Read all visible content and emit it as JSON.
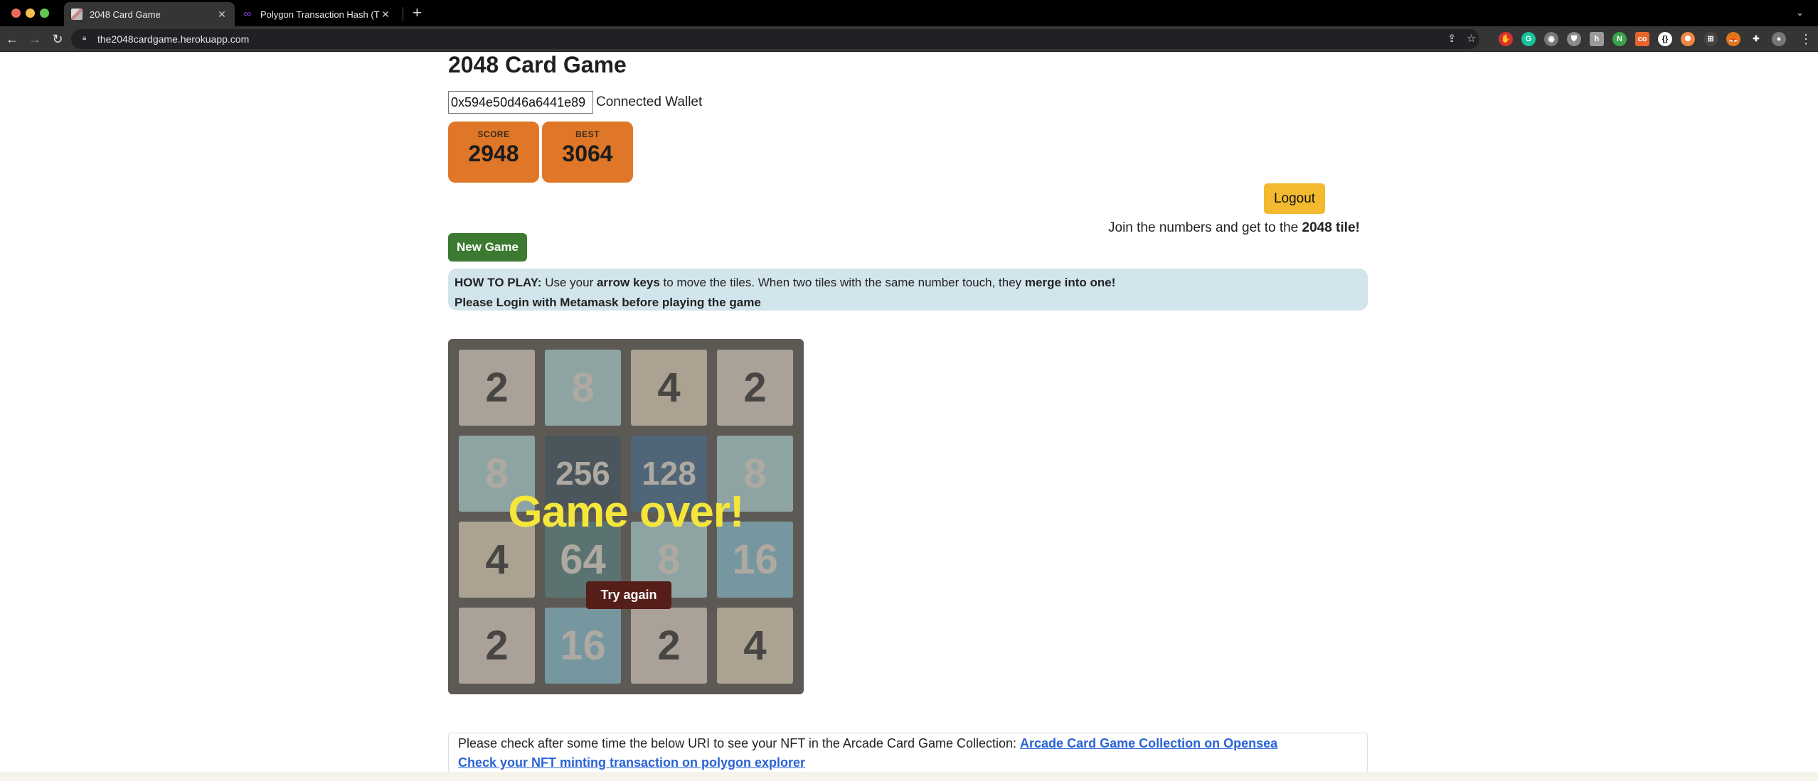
{
  "browser": {
    "tabs": [
      {
        "title": "2048 Card Game",
        "active": true,
        "favicon": "card-game-favicon"
      },
      {
        "title": "Polygon Transaction Hash (Txh",
        "active": false,
        "favicon": "polygon-favicon"
      }
    ],
    "url": "the2048cardgame.herokuapp.com",
    "extensions": [
      {
        "name": "adblock-icon",
        "color": "#d9302c",
        "glyph": "✋"
      },
      {
        "name": "grammarly-icon",
        "color": "#15c39a",
        "glyph": "G"
      },
      {
        "name": "camera-icon",
        "color": "#777777",
        "glyph": "◉"
      },
      {
        "name": "shield-icon",
        "color": "#8a8a8a",
        "glyph": "⛊"
      },
      {
        "name": "h-extension-icon",
        "color": "#9a9a9a",
        "glyph": "ħ"
      },
      {
        "name": "n-extension-icon",
        "color": "#3aa34a",
        "glyph": "N"
      },
      {
        "name": "co-extension-icon",
        "color": "#e8642c",
        "glyph": "co",
        "badge": "off"
      },
      {
        "name": "bracket-extension-icon",
        "color": "#ffffff",
        "glyph": "{}"
      },
      {
        "name": "color-picker-icon",
        "color": "#e84",
        "glyph": "✺"
      },
      {
        "name": "screenshot-extension-icon",
        "color": "#444444",
        "glyph": "⊞"
      },
      {
        "name": "metamask-icon",
        "color": "#e2761b",
        "glyph": "🦊"
      },
      {
        "name": "puzzle-extensions-icon",
        "color": "#353535",
        "glyph": "✚"
      },
      {
        "name": "profile-avatar",
        "color": "#777777",
        "glyph": "●"
      }
    ]
  },
  "page": {
    "title": "2048 Card Game",
    "wallet_address": "0x594e50d46a6441e89",
    "wallet_label": "Connected Wallet",
    "score": {
      "label": "SCORE",
      "value": "2948"
    },
    "best": {
      "label": "BEST",
      "value": "3064"
    },
    "logout_label": "Logout",
    "tagline_prefix": "Join the numbers and get to the ",
    "tagline_bold": "2048 tile!",
    "new_game_label": "New Game",
    "howto": {
      "label": "HOW TO PLAY:",
      "t1": " Use your ",
      "b1": "arrow keys",
      "t2": " to move the tiles. When two tiles with the same number touch, they ",
      "b2": "merge into one!",
      "line2": "Please Login with Metamask before playing the game"
    },
    "board": {
      "rows": [
        [
          "2",
          "8",
          "4",
          "2"
        ],
        [
          "8",
          "256",
          "128",
          "8"
        ],
        [
          "4",
          "64",
          "8",
          "16"
        ],
        [
          "2",
          "16",
          "2",
          "4"
        ]
      ],
      "tile_colors": {
        "2": {
          "bg": "#afa59f",
          "fg": "#454343"
        },
        "4": {
          "bg": "#b0a796",
          "fg": "#454343"
        },
        "8": {
          "bg": "#91a9aa",
          "fg": "#b3aea8"
        },
        "16": {
          "bg": "#7799a6",
          "fg": "#b3aea8"
        },
        "64": {
          "bg": "#587272",
          "fg": "#b3aea8"
        },
        "128": {
          "bg": "#4e647a",
          "fg": "#b3aea8"
        },
        "256": {
          "bg": "#47535d",
          "fg": "#b3aea8"
        }
      },
      "game_over_text": "Game over!",
      "try_again_label": "Try again"
    },
    "nft": {
      "text": "Please check after some time the below URI to see your NFT in the Arcade Card Game Collection: ",
      "opensea_link": "Arcade Card Game Collection on Opensea",
      "explorer_link": "Check your NFT minting transaction on polygon explorer"
    }
  }
}
